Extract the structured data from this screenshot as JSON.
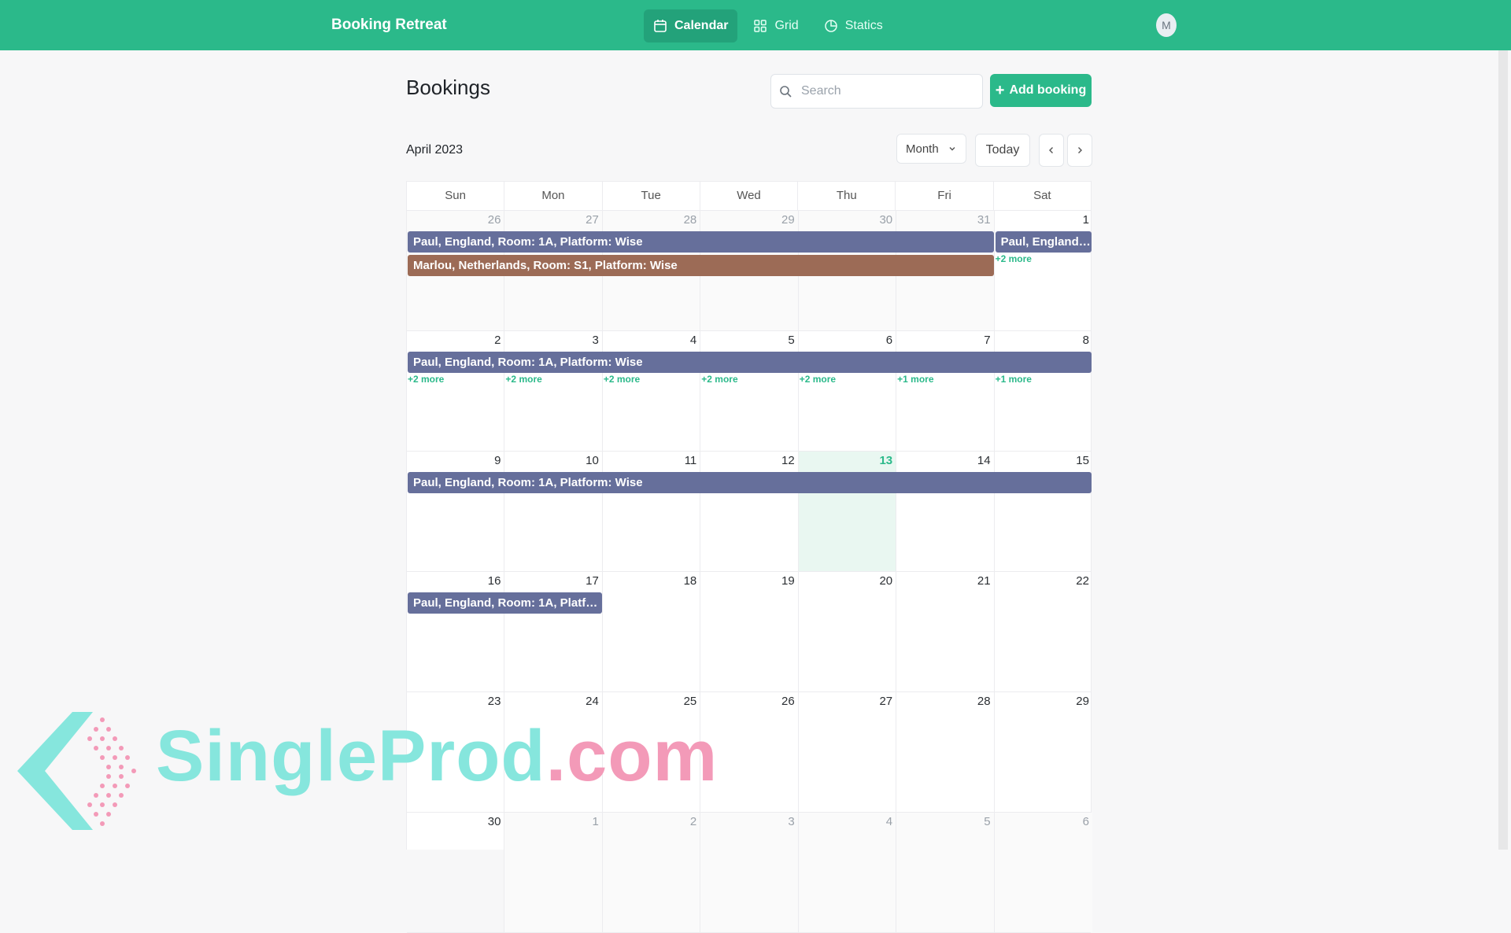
{
  "app": {
    "title": "Booking Retreat"
  },
  "nav": {
    "items": [
      {
        "label": "Calendar",
        "icon": "calendar-icon",
        "active": true
      },
      {
        "label": "Grid",
        "icon": "grid-icon",
        "active": false
      },
      {
        "label": "Statics",
        "icon": "pie-chart-icon",
        "active": false
      }
    ],
    "avatar_initial": "M"
  },
  "page": {
    "title": "Bookings",
    "search_placeholder": "Search",
    "add_label": "Add booking",
    "month_label": "April 2023",
    "view_select": "Month",
    "today_label": "Today",
    "prev_icon": "chevron-left-icon",
    "next_icon": "chevron-right-icon"
  },
  "calendar": {
    "weekdays": [
      "Sun",
      "Mon",
      "Tue",
      "Wed",
      "Thu",
      "Fri",
      "Sat"
    ],
    "today": 13,
    "weeks": [
      {
        "days": [
          {
            "n": "26",
            "out": true
          },
          {
            "n": "27",
            "out": true
          },
          {
            "n": "28",
            "out": true
          },
          {
            "n": "29",
            "out": true
          },
          {
            "n": "30",
            "out": true
          },
          {
            "n": "31",
            "out": true
          },
          {
            "n": "1",
            "out": false
          }
        ],
        "events": [
          {
            "label": "Paul, England, Room: 1A, Platform: Wise",
            "start": 0,
            "span": 6,
            "lane": 0,
            "color": "#666f9b"
          },
          {
            "label": "Marlou, Netherlands, Room: S1, Platform: Wise",
            "start": 0,
            "span": 6,
            "lane": 1,
            "color": "#9c6b56"
          },
          {
            "label": "Paul, England, R...",
            "start": 6,
            "span": 1,
            "lane": 0,
            "color": "#666f9b"
          }
        ],
        "more": [
          {
            "col": 6,
            "label": "+2 more",
            "lane": 1
          }
        ]
      },
      {
        "days": [
          {
            "n": "2",
            "out": false
          },
          {
            "n": "3",
            "out": false
          },
          {
            "n": "4",
            "out": false
          },
          {
            "n": "5",
            "out": false
          },
          {
            "n": "6",
            "out": false
          },
          {
            "n": "7",
            "out": false
          },
          {
            "n": "8",
            "out": false
          }
        ],
        "events": [
          {
            "label": "Paul, England, Room: 1A, Platform: Wise",
            "start": 0,
            "span": 7,
            "lane": 0,
            "color": "#666f9b"
          }
        ],
        "more": [
          {
            "col": 0,
            "label": "+2 more",
            "lane": 1
          },
          {
            "col": 1,
            "label": "+2 more",
            "lane": 1
          },
          {
            "col": 2,
            "label": "+2 more",
            "lane": 1
          },
          {
            "col": 3,
            "label": "+2 more",
            "lane": 1
          },
          {
            "col": 4,
            "label": "+2 more",
            "lane": 1
          },
          {
            "col": 5,
            "label": "+1 more",
            "lane": 1
          },
          {
            "col": 6,
            "label": "+1 more",
            "lane": 1
          }
        ]
      },
      {
        "days": [
          {
            "n": "9",
            "out": false
          },
          {
            "n": "10",
            "out": false
          },
          {
            "n": "11",
            "out": false
          },
          {
            "n": "12",
            "out": false
          },
          {
            "n": "13",
            "out": false,
            "today": true
          },
          {
            "n": "14",
            "out": false
          },
          {
            "n": "15",
            "out": false
          }
        ],
        "events": [
          {
            "label": "Paul, England, Room: 1A, Platform: Wise",
            "start": 0,
            "span": 7,
            "lane": 0,
            "color": "#666f9b"
          }
        ],
        "more": []
      },
      {
        "days": [
          {
            "n": "16",
            "out": false
          },
          {
            "n": "17",
            "out": false
          },
          {
            "n": "18",
            "out": false
          },
          {
            "n": "19",
            "out": false
          },
          {
            "n": "20",
            "out": false
          },
          {
            "n": "21",
            "out": false
          },
          {
            "n": "22",
            "out": false
          }
        ],
        "events": [
          {
            "label": "Paul, England, Room: 1A, Platform: ...",
            "start": 0,
            "span": 2,
            "lane": 0,
            "color": "#666f9b"
          }
        ],
        "more": []
      },
      {
        "days": [
          {
            "n": "23",
            "out": false
          },
          {
            "n": "24",
            "out": false
          },
          {
            "n": "25",
            "out": false
          },
          {
            "n": "26",
            "out": false
          },
          {
            "n": "27",
            "out": false
          },
          {
            "n": "28",
            "out": false
          },
          {
            "n": "29",
            "out": false
          }
        ],
        "events": [],
        "more": []
      },
      {
        "days": [
          {
            "n": "30",
            "out": false
          },
          {
            "n": "1",
            "out": true
          },
          {
            "n": "2",
            "out": true
          },
          {
            "n": "3",
            "out": true
          },
          {
            "n": "4",
            "out": true
          },
          {
            "n": "5",
            "out": true
          },
          {
            "n": "6",
            "out": true
          }
        ],
        "events": [],
        "more": []
      }
    ]
  },
  "watermark": {
    "text_main": "SingleProd",
    "text_tld": ".com",
    "main_color": "#86e6dd",
    "tld_color": "#f39ab8"
  },
  "colors": {
    "accent": "#2bb98a",
    "event_blue": "#666f9b",
    "event_brown": "#9c6b56"
  }
}
